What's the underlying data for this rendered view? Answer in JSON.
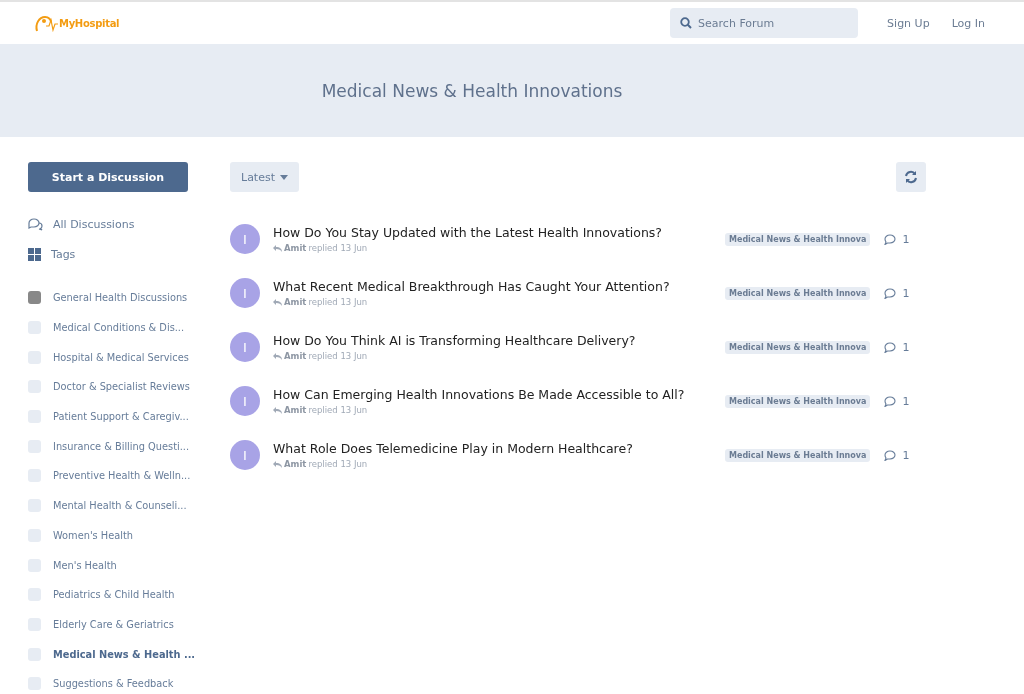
{
  "header": {
    "logo": "MyHospital",
    "search": {
      "placeholder": "Search Forum"
    },
    "links": [
      "Sign Up",
      "Log In"
    ]
  },
  "hero": {
    "title": "Medical News & Health Innovations"
  },
  "sidebar": {
    "start_button": "Start a Discussion",
    "nav": [
      {
        "label": "All Discussions",
        "kind": "discussions"
      },
      {
        "label": "Tags",
        "kind": "tags"
      }
    ],
    "categories": [
      {
        "label": "General Health Discussions",
        "color": "#888888",
        "selected": false
      },
      {
        "label": "Medical Conditions & Dis...",
        "color": "#e7ecf3",
        "selected": false
      },
      {
        "label": "Hospital & Medical Services",
        "color": "#e7ecf3",
        "selected": false
      },
      {
        "label": "Doctor & Specialist Reviews",
        "color": "#e7ecf3",
        "selected": false
      },
      {
        "label": "Patient Support & Caregiv...",
        "color": "#e7ecf3",
        "selected": false
      },
      {
        "label": "Insurance & Billing Questi...",
        "color": "#e7ecf3",
        "selected": false
      },
      {
        "label": "Preventive Health & Welln...",
        "color": "#e7ecf3",
        "selected": false
      },
      {
        "label": "Mental Health & Counseli...",
        "color": "#e7ecf3",
        "selected": false
      },
      {
        "label": "Women's Health",
        "color": "#e7ecf3",
        "selected": false
      },
      {
        "label": "Men's Health",
        "color": "#e7ecf3",
        "selected": false
      },
      {
        "label": "Pediatrics & Child Health",
        "color": "#e7ecf3",
        "selected": false
      },
      {
        "label": "Elderly Care & Geriatrics",
        "color": "#e7ecf3",
        "selected": false
      },
      {
        "label": "Medical News & Health ...",
        "color": "#e7ecf3",
        "selected": true
      },
      {
        "label": "Suggestions & Feedback",
        "color": "#e7ecf3",
        "selected": false
      }
    ]
  },
  "toolbar": {
    "sort": "Latest"
  },
  "discussions": [
    {
      "avatar": "I",
      "title": "How Do You Stay Updated with the Latest Health Innovations?",
      "user": "Amit",
      "action": "replied 13 Jun",
      "tag": "Medical News & Health Innova",
      "replies": "1"
    },
    {
      "avatar": "I",
      "title": "What Recent Medical Breakthrough Has Caught Your Attention?",
      "user": "Amit",
      "action": "replied 13 Jun",
      "tag": "Medical News & Health Innova",
      "replies": "1"
    },
    {
      "avatar": "I",
      "title": "How Do You Think AI is Transforming Healthcare Delivery?",
      "user": "Amit",
      "action": "replied 13 Jun",
      "tag": "Medical News & Health Innova",
      "replies": "1"
    },
    {
      "avatar": "I",
      "title": "How Can Emerging Health Innovations Be Made Accessible to All?",
      "user": "Amit",
      "action": "replied 13 Jun",
      "tag": "Medical News & Health Innova",
      "replies": "1"
    },
    {
      "avatar": "I",
      "title": "What Role Does Telemedicine Play in Modern Healthcare?",
      "user": "Amit",
      "action": "replied 13 Jun",
      "tag": "Medical News & Health Innova",
      "replies": "1"
    }
  ]
}
